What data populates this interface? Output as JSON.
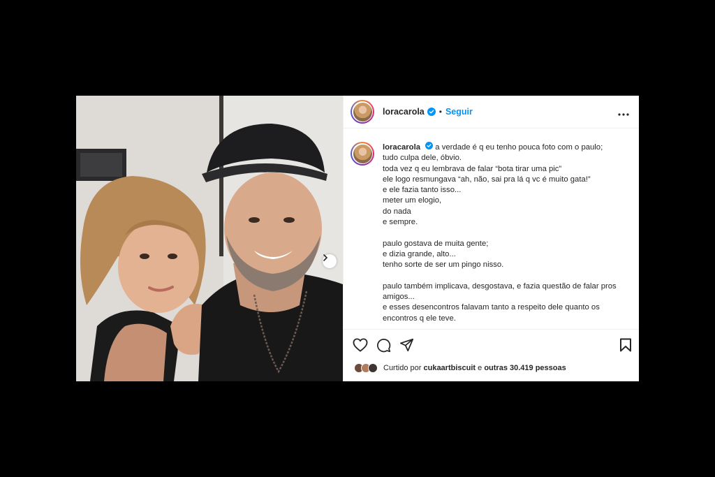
{
  "post": {
    "username": "loracarola",
    "follow_label": "Seguir",
    "dot": "•",
    "caption_username": "loracarola",
    "caption_lines": [
      "a verdade é q eu tenho pouca foto com o paulo;",
      "tudo culpa dele, óbvio.",
      "toda vez q eu lembrava de falar “bota tirar uma pic”",
      "ele logo resmungava “ah, não, sai pra lá q vc é muito gata!”",
      "e ele fazia tanto isso...",
      "meter um elogio,",
      "do nada",
      "e sempre.",
      "",
      "paulo gostava de muita gente;",
      "e dizia grande, alto...",
      "tenho sorte de ser um pingo nisso.",
      "",
      "paulo também implicava, desgostava, e fazia questão de falar pros",
      "amigos...",
      "e esses desencontros falavam tanto a respeito dele quanto os",
      "encontros q ele teve."
    ],
    "likes": {
      "prefix": "Curtido por",
      "user": "cukaartbiscuit",
      "middle": "e",
      "others": "outras 30.419 pessoas"
    }
  },
  "icons": {
    "verified": "verified-badge-icon",
    "more": "more-options-icon",
    "like": "heart-icon",
    "comment": "comment-icon",
    "share": "send-icon",
    "save": "bookmark-icon",
    "next": "chevron-right-icon"
  },
  "colors": {
    "accent": "#0095f6",
    "text": "#262626",
    "border": "#efefef",
    "backdrop": "#000000"
  }
}
